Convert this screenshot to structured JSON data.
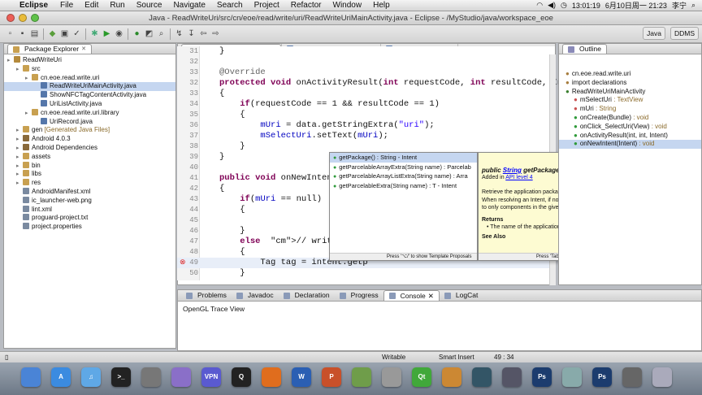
{
  "menubar": {
    "app": "Eclipse",
    "items": [
      "File",
      "Edit",
      "Run",
      "Source",
      "Navigate",
      "Search",
      "Project",
      "Refactor",
      "Window",
      "Help"
    ],
    "clock": "13:01:19",
    "date": "6月10日周一 21:23",
    "user": "李宁"
  },
  "window": {
    "title": "Java - ReadWriteUri/src/cn/eoe/read/write/uri/ReadWriteUriMainActivity.java - Eclipse - /MyStudio/java/workspace_eoe"
  },
  "perspectives": {
    "java": "Java",
    "ddms": "DDMS"
  },
  "package_explorer": {
    "title": "Package Explorer",
    "close": "✕",
    "rows": [
      {
        "label": "ReadWriteUri",
        "suffix": "",
        "indent": 0,
        "type": "project"
      },
      {
        "label": "src",
        "suffix": "",
        "indent": 1,
        "type": "folder"
      },
      {
        "label": "cn.eoe.read.write.uri",
        "suffix": "",
        "indent": 2,
        "type": "package"
      },
      {
        "label": "ReadWriteUriMainActivity.java",
        "suffix": "",
        "indent": 3,
        "type": "java",
        "selected": true
      },
      {
        "label": "ShowNFCTagContentActivity.java",
        "suffix": "",
        "indent": 3,
        "type": "java"
      },
      {
        "label": "UriListActivity.java",
        "suffix": "",
        "indent": 3,
        "type": "java"
      },
      {
        "label": "cn.eoe.read.write.uri.library",
        "suffix": "",
        "indent": 2,
        "type": "package"
      },
      {
        "label": "UriRecord.java",
        "suffix": "",
        "indent": 3,
        "type": "java"
      },
      {
        "label": "gen",
        "suffix": "[Generated Java Files]",
        "indent": 1,
        "type": "folder"
      },
      {
        "label": "Android 4.0.3",
        "suffix": "",
        "indent": 1,
        "type": "lib"
      },
      {
        "label": "Android Dependencies",
        "suffix": "",
        "indent": 1,
        "type": "lib"
      },
      {
        "label": "assets",
        "suffix": "",
        "indent": 1,
        "type": "folder"
      },
      {
        "label": "bin",
        "suffix": "",
        "indent": 1,
        "type": "folder"
      },
      {
        "label": "libs",
        "suffix": "",
        "indent": 1,
        "type": "folder"
      },
      {
        "label": "res",
        "suffix": "",
        "indent": 1,
        "type": "folder"
      },
      {
        "label": "AndroidManifest.xml",
        "suffix": "",
        "indent": 1,
        "type": "file"
      },
      {
        "label": "ic_launcher-web.png",
        "suffix": "",
        "indent": 1,
        "type": "file"
      },
      {
        "label": "lint.xml",
        "suffix": "",
        "indent": 1,
        "type": "file"
      },
      {
        "label": "proguard-project.txt",
        "suffix": "",
        "indent": 1,
        "type": "file"
      },
      {
        "label": "project.properties",
        "suffix": "",
        "indent": 1,
        "type": "file"
      }
    ]
  },
  "editor": {
    "tabs": [
      {
        "label": "*ReadWriteUriMainAct",
        "active": true
      },
      {
        "label": "ShowNFCTagContentAct",
        "active": false
      },
      {
        "label": "UriListActivity.java",
        "active": false
      },
      {
        "label": "»2",
        "active": false
      }
    ],
    "lines": [
      {
        "n": "31",
        "code": "}"
      },
      {
        "n": "32",
        "code": ""
      },
      {
        "n": "33",
        "code": "@Override"
      },
      {
        "n": "32",
        "code": "protected void onActivityResult(int requestCode, int resultCode, Intent d"
      },
      {
        "n": "33",
        "code": "{"
      },
      {
        "n": "34",
        "code": "    if(requestCode == 1 && resultCode == 1)"
      },
      {
        "n": "35",
        "code": "    {"
      },
      {
        "n": "36",
        "code": "        mUri = data.getStringExtra(\"uri\");"
      },
      {
        "n": "37",
        "code": "        mSelectUri.setText(mUri);"
      },
      {
        "n": "38",
        "code": "    }"
      },
      {
        "n": "39",
        "code": "}"
      },
      {
        "n": "40",
        "code": ""
      },
      {
        "n": "41",
        "code": "public void onNewIntent(I"
      },
      {
        "n": "42",
        "code": "{"
      },
      {
        "n": "43",
        "code": "    if(mUri == null)"
      },
      {
        "n": "44",
        "code": "    {"
      },
      {
        "n": "45",
        "code": ""
      },
      {
        "n": "46",
        "code": "    }"
      },
      {
        "n": "47",
        "code": "    else  // write nfc"
      },
      {
        "n": "48",
        "code": "    {"
      },
      {
        "n": "49",
        "code": "        Tag tag = intent.getp"
      },
      {
        "n": "50",
        "code": "    }"
      }
    ]
  },
  "proposals": {
    "items": [
      "getPackage() : String - Intent",
      "getParcelableArrayExtra(String name) : Parcelab",
      "getParcelableArrayListExtra(String name) : Arra",
      "getParcelableExtra(String name) : T - Intent"
    ],
    "footer": "Press '⌥/' to show Template Proposals"
  },
  "javadoc": {
    "pre": "public ",
    "type": "String",
    "method": " getPackage ()",
    "added_in": "Added in ",
    "api": "API level 4",
    "body": "Retrieve the application package name this Intent is limited to. When resolving an Intent, if non-null this limits the resolution to only components in the given application package.",
    "returns_h": "Returns",
    "returns": "The name of the application package for the Intent.",
    "see_also": "See Also",
    "footer": "Press 'Tab' from proposal table or click for focus"
  },
  "outline": {
    "title": "Outline",
    "rows": [
      {
        "label": "cn.eoe.read.write.uri",
        "suffix": "",
        "indent": 0,
        "color": "#a67c3c"
      },
      {
        "label": "import declarations",
        "suffix": "",
        "indent": 0,
        "color": "#a67c3c"
      },
      {
        "label": "ReadWriteUriMainActivity",
        "suffix": "",
        "indent": 0,
        "color": "#3a7f2e"
      },
      {
        "label": "mSelectUri",
        "suffix": " : TextView",
        "indent": 1,
        "color": "#c85050"
      },
      {
        "label": "mUri",
        "suffix": " : String",
        "indent": 1,
        "color": "#c85050"
      },
      {
        "label": "onCreate(Bundle)",
        "suffix": " : void",
        "indent": 1,
        "color": "#2f9a3a"
      },
      {
        "label": "onClick_SelectUri(View)",
        "suffix": " : void",
        "indent": 1,
        "color": "#2f9a3a"
      },
      {
        "label": "onActivityResult(int, int, Intent)",
        "suffix": "",
        "indent": 1,
        "color": "#2f9a3a"
      },
      {
        "label": "onNewIntent(Intent)",
        "suffix": " : void",
        "indent": 1,
        "color": "#2f9a3a",
        "selected": true
      }
    ]
  },
  "bottom": {
    "tabs": [
      {
        "label": "Problems",
        "active": false
      },
      {
        "label": "Javadoc",
        "active": false
      },
      {
        "label": "Declaration",
        "active": false
      },
      {
        "label": "Progress",
        "active": false
      },
      {
        "label": "Console",
        "active": true
      },
      {
        "label": "LogCat",
        "active": false
      }
    ],
    "console_title": "OpenGL Trace View"
  },
  "status": {
    "writable": "Writable",
    "insert": "Smart Insert",
    "position": "49 : 34"
  },
  "dock": {
    "items": [
      {
        "name": "finder",
        "label": "",
        "color": "#4a84d6"
      },
      {
        "name": "appstore",
        "label": "A",
        "color": "#3b8be0"
      },
      {
        "name": "itunes",
        "label": "♫",
        "color": "#5fa8e6"
      },
      {
        "name": "terminal",
        "label": ">_",
        "color": "#222"
      },
      {
        "name": "photos",
        "label": "",
        "color": "#777"
      },
      {
        "name": "spotlight",
        "label": "",
        "color": "#8a6fc8"
      },
      {
        "name": "vpn",
        "label": "VPN",
        "color": "#5a5ad0"
      },
      {
        "name": "qq",
        "label": "Q",
        "color": "#222"
      },
      {
        "name": "firefox",
        "label": "",
        "color": "#e06d1d"
      },
      {
        "name": "word",
        "label": "W",
        "color": "#2b5fb3"
      },
      {
        "name": "powerpoint",
        "label": "P",
        "color": "#c8502a"
      },
      {
        "name": "misc1",
        "label": "",
        "color": "#6f9d4a"
      },
      {
        "name": "misc2",
        "label": "",
        "color": "#999"
      },
      {
        "name": "qt",
        "label": "Qt",
        "color": "#41a83a"
      },
      {
        "name": "misc3",
        "label": "",
        "color": "#c83"
      },
      {
        "name": "misc4",
        "label": "",
        "color": "#356"
      },
      {
        "name": "misc5",
        "label": "",
        "color": "#556"
      },
      {
        "name": "photoshop",
        "label": "Ps",
        "color": "#1c3c6e"
      },
      {
        "name": "misc6",
        "label": "",
        "color": "#8aa"
      },
      {
        "name": "photoshop2",
        "label": "Ps",
        "color": "#1c3c6e"
      },
      {
        "name": "misc7",
        "label": "",
        "color": "#666"
      },
      {
        "name": "trash",
        "label": "",
        "color": "#aab"
      }
    ]
  }
}
